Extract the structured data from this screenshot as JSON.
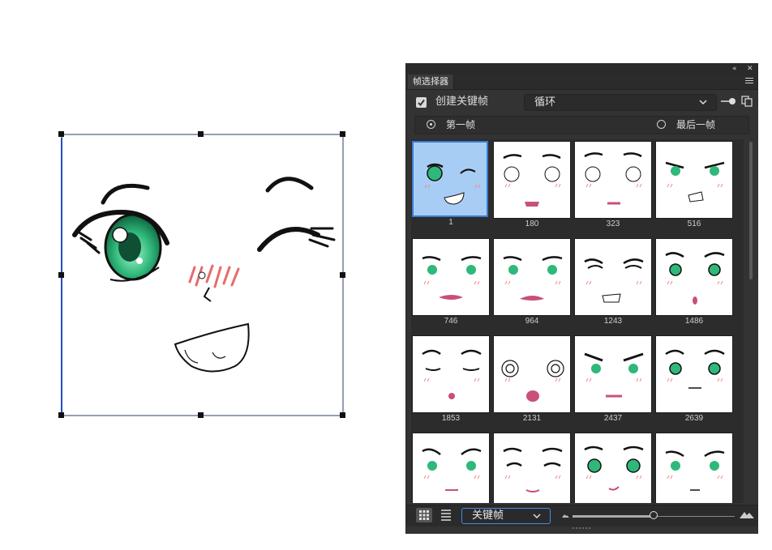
{
  "panel": {
    "tab_title": "帧选择器",
    "collapse_icon": "double-chevron-left",
    "close_icon": "close-x",
    "create_keyframe_label": "创建关键帧",
    "create_keyframe_checked": true,
    "loop_select": {
      "value": "循环"
    },
    "radio_first": {
      "label": "第一帧",
      "selected": true
    },
    "radio_last": {
      "label": "最后一帧",
      "selected": false
    },
    "frames": [
      {
        "label": "1",
        "selected": true
      },
      {
        "label": "180"
      },
      {
        "label": "323"
      },
      {
        "label": "516"
      },
      {
        "label": "746"
      },
      {
        "label": "964"
      },
      {
        "label": "1243"
      },
      {
        "label": "1486"
      },
      {
        "label": "1853"
      },
      {
        "label": "2131"
      },
      {
        "label": "2437"
      },
      {
        "label": "2639"
      },
      {
        "label": ""
      },
      {
        "label": ""
      },
      {
        "label": ""
      },
      {
        "label": ""
      }
    ],
    "filter_select": {
      "value": "关键帧"
    },
    "thumbnail_size": 0.5
  },
  "colors": {
    "panel_bg": "#333333",
    "selection_bg": "#a8cdf5",
    "accent": "#3f8fe8",
    "eye_green": "#2fb87a"
  }
}
